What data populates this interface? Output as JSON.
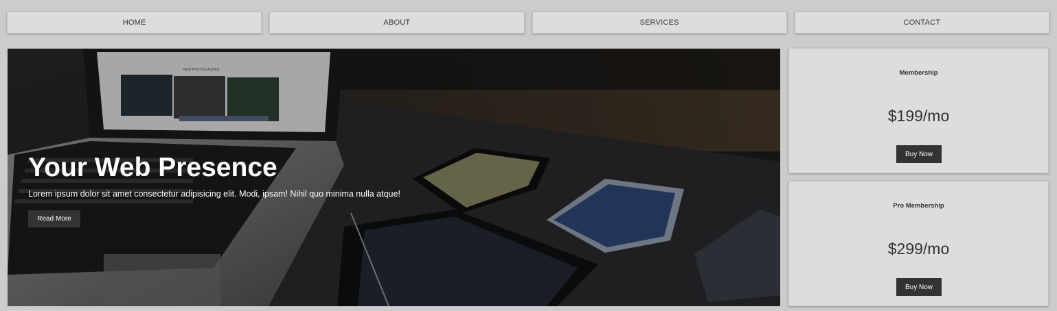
{
  "nav": {
    "items": [
      {
        "label": "HOME"
      },
      {
        "label": "ABOUT"
      },
      {
        "label": "SERVICES"
      },
      {
        "label": "CONTACT"
      }
    ]
  },
  "hero": {
    "title": "Your Web Presence",
    "text": "Lorem ipsum dolor sit amet consectetur adipisicing elit. Modi, ipsam! Nihil quo minima nulla atque!",
    "button_label": "Read More",
    "screen_caption": "NEW PHOTOS ADDED"
  },
  "pricing": [
    {
      "title": "Membership",
      "price": "$199/mo",
      "button_label": "Buy Now"
    },
    {
      "title": "Pro Membership",
      "price": "$299/mo",
      "button_label": "Buy Now"
    }
  ],
  "colors": {
    "page_bg": "#cccccc",
    "nav_bg": "#dddddd",
    "button_bg": "#333333",
    "button_text": "#ffffff"
  }
}
